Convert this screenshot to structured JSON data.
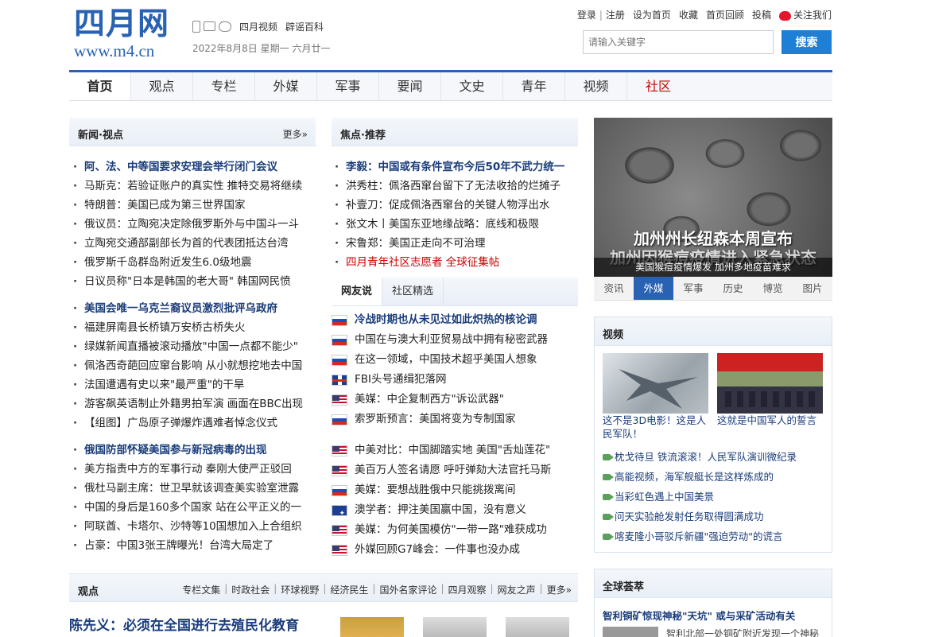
{
  "header": {
    "logo_cn": "四月网",
    "logo_url": "www.m4.cn",
    "link_video": "四月视频",
    "link_rumor": "辟谣百科",
    "date": "2022年8月8日 星期一 六月廿一",
    "login": "登录",
    "register": "注册",
    "set_home": "设为首页",
    "favorite": "收藏",
    "home_back": "首页回顾",
    "submit": "投稿",
    "follow": "关注我们",
    "search_placeholder": "请输入关键字",
    "search_btn": "搜索"
  },
  "nav": [
    "首页",
    "观点",
    "专栏",
    "外媒",
    "军事",
    "要闻",
    "文史",
    "青年",
    "视频",
    "社区"
  ],
  "news_view": {
    "title": "新闻·视点",
    "more": "更多»",
    "items": [
      {
        "text": "阿、法、中等国要求安理会举行闭门会议",
        "bold": true
      },
      {
        "text": "马斯克：若验证账户的真实性 推特交易将继续"
      },
      {
        "text": "特朗普：美国已成为第三世界国家"
      },
      {
        "text": "俄议员：立陶宛决定除俄罗斯外与中国斗一斗"
      },
      {
        "text": "立陶宛交通部副部长为首的代表团抵达台湾"
      },
      {
        "text": "俄罗斯千岛群岛附近发生6.0级地震"
      },
      {
        "text": "日议员称\"日本是韩国的老大哥\" 韩国网民愤"
      },
      {
        "text": "美国会唯一乌克兰裔议员激烈批评乌政府",
        "bold": true
      },
      {
        "text": "福建屏南县长桥镇万安桥古桥失火"
      },
      {
        "text": "绿媒新闻直播被滚动播放\"中国一点都不能少\""
      },
      {
        "text": "佩洛西奇葩回应窜台影响 从小就想挖地去中国"
      },
      {
        "text": "法国遭遇有史以来\"最严重\"的干旱"
      },
      {
        "text": "游客飙英语制止外籍男拍军演 画面在BBC出现"
      },
      {
        "text": "【组图】广岛原子弹爆炸遇难者悼念仪式"
      },
      {
        "text": "俄国防部怀疑美国参与新冠病毒的出现",
        "bold": true
      },
      {
        "text": "美方指责中方的军事行动 秦刚大使严正驳回"
      },
      {
        "text": "俄杜马副主席：世卫早就该调查美实验室泄露"
      },
      {
        "text": "中国的身后是160多个国家 站在公平正义的一"
      },
      {
        "text": "阿联酋、卡塔尔、沙特等10国想加入上合组织"
      },
      {
        "text": "占豪：中国3张王牌曝光！台湾大局定了"
      }
    ]
  },
  "focus": {
    "title": "焦点·推荐",
    "items": [
      {
        "text": "李毅：中国或有条件宣布今后50年不武力统一",
        "bold": true
      },
      {
        "text": "洪秀柱：佩洛西窜台留下了无法收拾的烂摊子"
      },
      {
        "text": "补壹刀：促成佩洛西窜台的关键人物浮出水"
      },
      {
        "text": "张文木丨美国东亚地缘战略：底线和极限"
      },
      {
        "text": "宋鲁郑：美国正走向不可治理"
      },
      {
        "text": "四月青年社区志愿者 全球征集帖",
        "red": true
      }
    ]
  },
  "netizen": {
    "tabs": [
      "网友说",
      "社区精选"
    ],
    "items": [
      {
        "flag": "ru",
        "text": "冷战时期也从未见过如此炽热的核论调",
        "bold": true
      },
      {
        "flag": "ru",
        "text": "中国在与澳大利亚贸易战中拥有秘密武器"
      },
      {
        "flag": "ru",
        "text": "在这一领域，中国技术超乎美国人想象"
      },
      {
        "flag": "uk",
        "text": "FBI头号通缉犯落网"
      },
      {
        "flag": "us",
        "text": "美媒：中企复制西方\"诉讼武器\""
      },
      {
        "flag": "ru",
        "text": "索罗斯预言：美国将变为专制国家"
      },
      {
        "flag": "us",
        "text": "中美对比：中国脚踏实地 美国\"舌灿莲花\""
      },
      {
        "flag": "us",
        "text": "美百万人签名请愿 呼吁弹劾大法官托马斯"
      },
      {
        "flag": "ru",
        "text": "美媒：要想战胜俄中只能挑拨离间"
      },
      {
        "flag": "au",
        "text": "澳学者：押注美国赢中国，没有意义"
      },
      {
        "flag": "us",
        "text": "美媒：为何美国模仿\"一带一路\"难获成功"
      },
      {
        "flag": "us",
        "text": "外媒回顾G7峰会：一件事也没办成"
      }
    ]
  },
  "hero": {
    "overlay": "加州州长纽森本周宣布",
    "overlay2": "加州因猴痘疫情进入紧急状态",
    "caption": "美国猴痘疫情爆发 加州多地疫苗难求",
    "tabs": [
      "资讯",
      "外媒",
      "军事",
      "历史",
      "博览",
      "图片"
    ]
  },
  "video": {
    "title": "视频",
    "cap1": "这不是3D电影！这是人民军队！",
    "cap2": "这就是中国军人的誓言",
    "items": [
      "枕戈待旦 铁流滚滚！人民军队演训微纪录",
      "高能视频，海军舰艇长是这样炼成的",
      "当彩虹色遇上中国美景",
      "问天实验舱发射任务取得圆满成功",
      "喀麦隆小哥驳斥新疆\"强迫劳动\"的谎言"
    ]
  },
  "global": {
    "title": "全球荟萃",
    "headline": "智利铜矿惊现神秘\"天坑\" 或与采矿活动有关",
    "snippet": "智利北部一处铜矿附近发现一个神秘"
  },
  "bottom": {
    "title": "观点",
    "links": [
      "专栏文集",
      "时政社会",
      "环球视野",
      "经济民生",
      "国外名家评论",
      "四月观察",
      "网友之声",
      "更多»"
    ],
    "headline": "陈先义：必须在全国进行去殖民化教育"
  },
  "colors": {
    "brand": "#2a62b3",
    "search": "#1e7fd6",
    "highlight": "#c00000"
  }
}
